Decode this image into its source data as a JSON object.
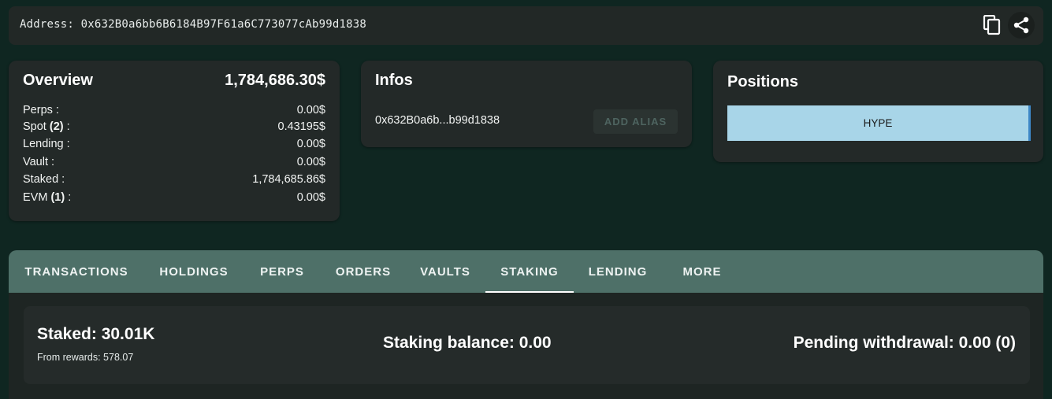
{
  "header": {
    "address_text": "Address: 0x632B0a6bb6B6184B97F61a6C773077cAb99d1838",
    "icons": [
      "copy-icon",
      "share-icon"
    ]
  },
  "overview": {
    "title": "Overview",
    "total": "1,784,686.30$",
    "rows": [
      {
        "label": "Perps :",
        "count": "",
        "suffix": "",
        "value": "0.00$"
      },
      {
        "label": "Spot ",
        "count": "(2)",
        "suffix": " :",
        "value": "0.43195$"
      },
      {
        "label": "Lending :",
        "count": "",
        "suffix": "",
        "value": "0.00$"
      },
      {
        "label": "Vault :",
        "count": "",
        "suffix": "",
        "value": "0.00$"
      },
      {
        "label": "Staked :",
        "count": "",
        "suffix": "",
        "value": "1,784,685.86$"
      },
      {
        "label": "EVM ",
        "count": "(1)",
        "suffix": " :",
        "value": "0.00$"
      }
    ]
  },
  "infos": {
    "title": "Infos",
    "short_address": "0x632B0a6b...b99d1838",
    "add_alias_label": "ADD ALIAS"
  },
  "positions": {
    "title": "Positions",
    "items": [
      {
        "label": "HYPE",
        "color": "#a8d5e8"
      }
    ]
  },
  "tabs": [
    {
      "label": "TRANSACTIONS",
      "active": false
    },
    {
      "label": "HOLDINGS",
      "active": false
    },
    {
      "label": "PERPS",
      "active": false
    },
    {
      "label": "ORDERS",
      "active": false
    },
    {
      "label": "VAULTS",
      "active": false
    },
    {
      "label": "STAKING",
      "active": true
    },
    {
      "label": "LENDING",
      "active": false
    },
    {
      "label": "MORE",
      "active": false
    }
  ],
  "staking": {
    "staked": "Staked: 30.01K",
    "from_rewards": "From rewards: 578.07",
    "balance": "Staking balance: 0.00",
    "pending": "Pending withdrawal: 0.00 (0)"
  },
  "colors": {
    "background": "#0f2621",
    "card": "#232928",
    "tab_bar": "#4e7068",
    "position_hype": "#a8d5e8"
  }
}
